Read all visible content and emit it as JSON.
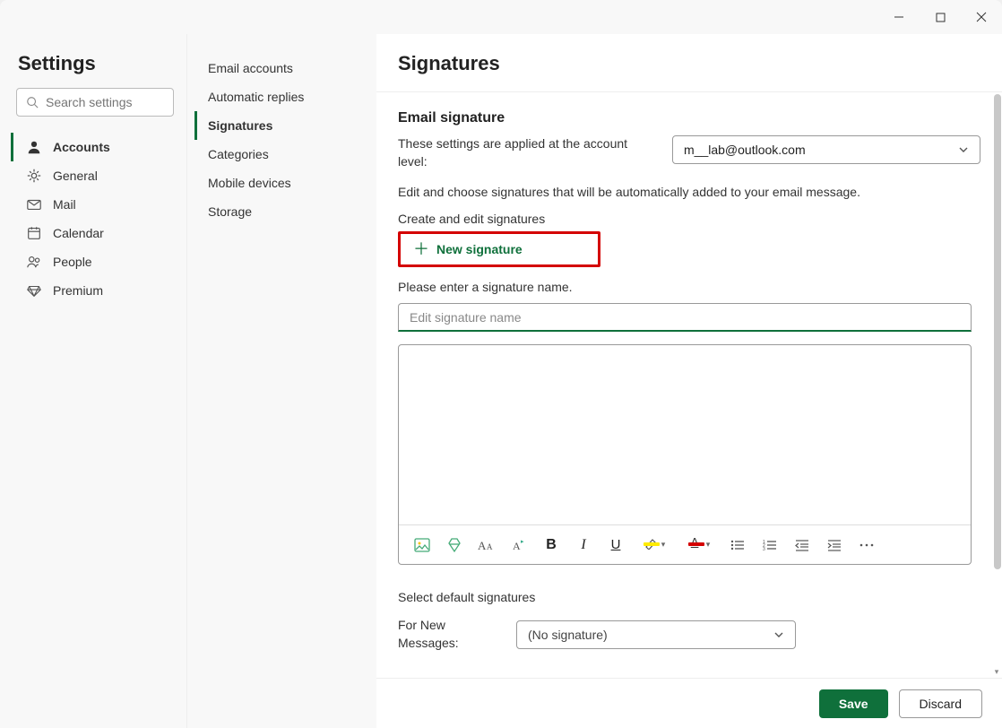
{
  "titlebar": {
    "minimize": "",
    "maximize": "",
    "close": ""
  },
  "nav1": {
    "title": "Settings",
    "search_placeholder": "Search settings",
    "items": [
      {
        "label": "Accounts",
        "icon": "person"
      },
      {
        "label": "General",
        "icon": "gear"
      },
      {
        "label": "Mail",
        "icon": "mail"
      },
      {
        "label": "Calendar",
        "icon": "calendar"
      },
      {
        "label": "People",
        "icon": "people"
      },
      {
        "label": "Premium",
        "icon": "diamond"
      }
    ]
  },
  "nav2": {
    "items": [
      {
        "label": "Email accounts"
      },
      {
        "label": "Automatic replies"
      },
      {
        "label": "Signatures"
      },
      {
        "label": "Categories"
      },
      {
        "label": "Mobile devices"
      },
      {
        "label": "Storage"
      }
    ]
  },
  "content": {
    "title": "Signatures",
    "section_h": "Email signature",
    "scope_label": "These settings are applied at the account level:",
    "account_value": "m__lab@outlook.com",
    "info": "Edit and choose signatures that will be automatically added to your email message.",
    "create_label": "Create and edit signatures",
    "new_sig": "New signature",
    "hint": "Please enter a signature name.",
    "name_placeholder": "Edit signature name",
    "defaults_h": "Select default signatures",
    "for_new_label": "For New Messages:",
    "for_new_value": "(No signature)",
    "save": "Save",
    "discard": "Discard"
  },
  "toolbar": {
    "bold": "B",
    "italic": "I",
    "underline": "U",
    "font_color": "A"
  }
}
